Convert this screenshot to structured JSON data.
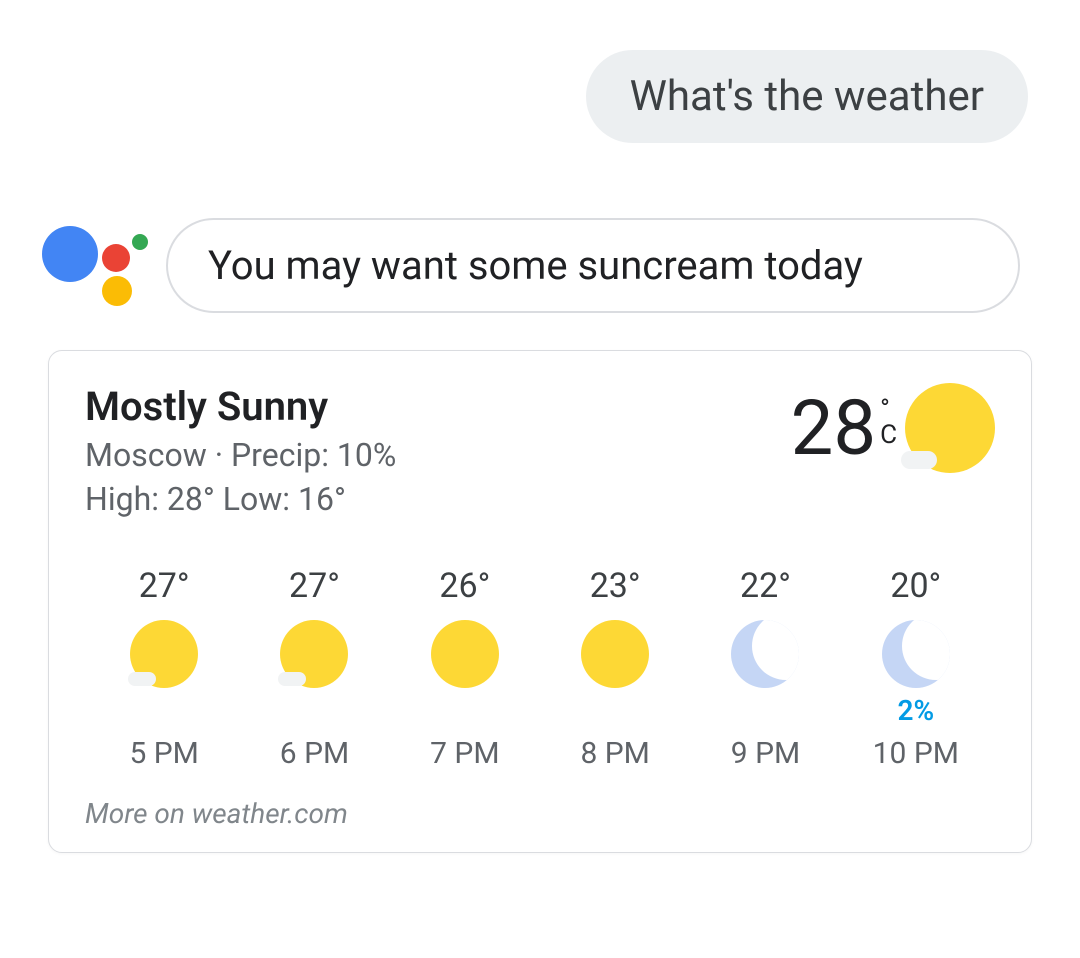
{
  "user": {
    "message": "What's the weather"
  },
  "assistant": {
    "reply": "You may want some suncream today"
  },
  "weather": {
    "summary": "Mostly Sunny",
    "location": "Moscow",
    "precip_label": "Precip: 10%",
    "high_low": "High: 28° Low: 16°",
    "current_temp": "28",
    "unit_deg": "°",
    "unit_scale": "C",
    "hours": [
      {
        "temp": "27°",
        "icon": "sun-cloud",
        "precip": "",
        "label": "5 PM"
      },
      {
        "temp": "27°",
        "icon": "sun-cloud",
        "precip": "",
        "label": "6 PM"
      },
      {
        "temp": "26°",
        "icon": "sun",
        "precip": "",
        "label": "7 PM"
      },
      {
        "temp": "23°",
        "icon": "sun",
        "precip": "",
        "label": "8 PM"
      },
      {
        "temp": "22°",
        "icon": "moon",
        "precip": "",
        "label": "9 PM"
      },
      {
        "temp": "20°",
        "icon": "moon",
        "precip": "2%",
        "label": "10 PM"
      }
    ],
    "more_link": "More on weather.com",
    "separator": " · "
  }
}
